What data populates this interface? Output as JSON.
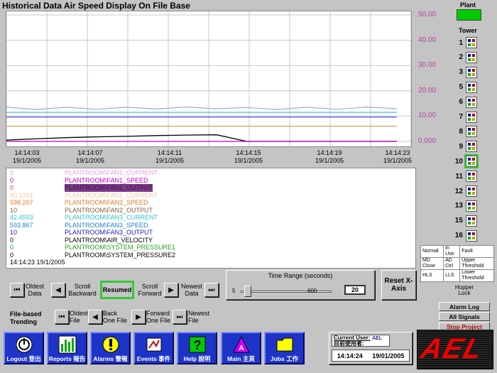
{
  "title": "Historical Data Air Speed Display On File Base",
  "chart_data": {
    "type": "line",
    "x": [
      "14:14:03 19/1/2005",
      "14:14:07 19/1/2005",
      "14:14:11 19/1/2005",
      "14:14:15 19/1/2005",
      "14:14:19 19/1/2005",
      "14:14:23 19/1/2005"
    ],
    "ylim": [
      0,
      50
    ],
    "y_ticks": [
      "0.000",
      "10.00",
      "20.00",
      "30.00",
      "40.00",
      "50.00"
    ],
    "grid": true,
    "series": [
      {
        "color": "#a8a8c8",
        "values": [
          13.5,
          12.6,
          13.5,
          12.7,
          13.5,
          12.8,
          13.6,
          12.9,
          13.4,
          12.6,
          13.5,
          12.7,
          13.6,
          12.9
        ]
      },
      {
        "color": "#40c8d8",
        "values": [
          11.5,
          11.5,
          11.5,
          11.5,
          11.5,
          11.5,
          11.5,
          11.5,
          11.5,
          11.5,
          11.5,
          11.5,
          11.5,
          11.5
        ]
      },
      {
        "color": "#4040f0",
        "values": [
          9.6,
          9.6,
          9.6,
          9.6,
          9.6,
          9.6,
          9.6,
          9.6,
          9.6,
          9.6,
          9.6,
          9.6,
          9.6,
          9.6
        ]
      },
      {
        "color": "#d8a060",
        "values": [
          6.0,
          6.0,
          6.0,
          6.0,
          6.0,
          6.0,
          6.0,
          6.0,
          6.0,
          6.0,
          6.0,
          6.0,
          6.0,
          6.0
        ]
      },
      {
        "color": "#000000",
        "values": [
          0.5,
          1.0,
          1.5,
          1.8,
          2.0,
          2.3,
          2.5,
          2.6,
          0.0,
          0.0,
          0.0,
          0.0,
          0.0,
          0.0
        ]
      },
      {
        "color": "#c000c0",
        "values": [
          0,
          0,
          0,
          0,
          0,
          0,
          0,
          0,
          0,
          0,
          0,
          0,
          0,
          0
        ]
      }
    ]
  },
  "legend": [
    {
      "value": "0",
      "name": "PLANTROOM\\FAN1_CURRENT",
      "color": "#e8a0e8"
    },
    {
      "value": "0",
      "name": "PLANTROOM\\FAN1_SPEED",
      "color": "#c000c0"
    },
    {
      "value": "0",
      "name": "PLANTROOM\\FAN1_OUTPUT",
      "color": "#a040a0",
      "selected": true
    },
    {
      "value": "40.1061",
      "name": "PLANTROOM\\FAN2_CURRENT",
      "color": "#f0c8a8"
    },
    {
      "value": "598.207",
      "name": "PLANTROOM\\FAN2_SPEED",
      "color": "#e87820"
    },
    {
      "value": "10",
      "name": "PLANTROOM\\FAN2_OUTPUT",
      "color": "#806040"
    },
    {
      "value": "42.4593",
      "name": "PLANTROOM\\FAN3_CURRENT",
      "color": "#30c0d0"
    },
    {
      "value": "593.867",
      "name": "PLANTROOM\\FAN3_SPEED",
      "color": "#2080c0"
    },
    {
      "value": "10",
      "name": "PLANTROOM\\FAN3_OUTPUT",
      "color": "#2020c0"
    },
    {
      "value": "0",
      "name": "PLANTROOM\\AIR_VELOCITY",
      "color": "#000000"
    },
    {
      "value": "0",
      "name": "PLANTROOM\\SYSTEM_PRESSURE1",
      "color": "#20a020"
    },
    {
      "value": "0",
      "name": "PLANTROOM\\SYSTEM_PRESSURE2",
      "color": "#000000"
    }
  ],
  "legend_time": "14:14:23   19/1/2005",
  "controls": {
    "oldest": "Oldest Data",
    "scroll_back": "Scroll Backward",
    "resumed": "Resumed",
    "scroll_fwd": "Scroll Forward",
    "newest": "Newest Data",
    "time_range_label": "Time Range (seconds)",
    "range_min": "5",
    "range_max": "600",
    "range_value": "20",
    "slider_fraction": 0.025,
    "reset": "Reset X-Axis"
  },
  "file_trending": {
    "label": "File-based Trending",
    "oldest_file": "Oldest File",
    "back_file": "Back One File",
    "forward_file": "Forward One File",
    "newest_file": "Newest File"
  },
  "plant": {
    "label": "Plant",
    "color": "#00cc00"
  },
  "tower": {
    "label": "Tower",
    "items": [
      "1",
      "2",
      "3",
      "5",
      "6",
      "7",
      "8",
      "9",
      "10",
      "11",
      "12",
      "13",
      "15",
      "16"
    ]
  },
  "status_table": [
    [
      "Normal",
      "In Use",
      "Fault"
    ],
    [
      "MD Close",
      "AD Ctrl",
      "Upper Threshold"
    ],
    [
      "HLS",
      "LLS",
      "Lower Threshold"
    ]
  ],
  "hopper_lock": "Hopper Lock",
  "side_buttons": {
    "alarm_log": "Alarm Log",
    "all_signals": "All Signals",
    "stop_project": "Stop Project"
  },
  "bottom_buttons": [
    {
      "label": "Logout 登出",
      "icon": "power-icon"
    },
    {
      "label": "Reports 報告",
      "icon": "bar-chart-icon"
    },
    {
      "label": "Alarms 警報",
      "icon": "alarm-icon"
    },
    {
      "label": "Events 事件",
      "icon": "events-icon"
    },
    {
      "label": "Help 說明",
      "icon": "help-icon"
    },
    {
      "label": "Main 主頁",
      "icon": "main-icon"
    },
    {
      "label": "Jobs 工作",
      "icon": "folder-icon"
    }
  ],
  "user": {
    "current_user_label": "Current User:",
    "current_user_zh": "目前使用者:",
    "name": "AEL",
    "time": "14:14:24",
    "date": "19/01/2005"
  },
  "logo": "AEL"
}
